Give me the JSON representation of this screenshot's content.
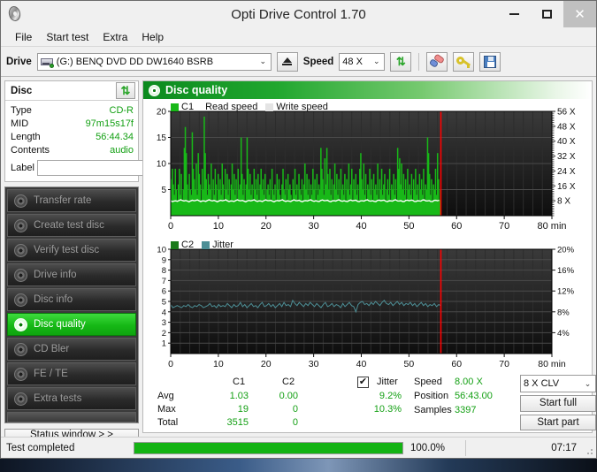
{
  "window": {
    "title": "Opti Drive Control 1.70",
    "app_icon": "disc-icon",
    "minimize": "–",
    "maximize": "□",
    "close": "✕"
  },
  "menu": {
    "items": [
      {
        "label": "File"
      },
      {
        "label": "Start test"
      },
      {
        "label": "Extra"
      },
      {
        "label": "Help"
      }
    ]
  },
  "toolbar": {
    "drive_label": "Drive",
    "drive_value": "(G:)   BENQ DVD DD DW1640 BSRB",
    "eject_icon": "eject-icon",
    "speed_label": "Speed",
    "speed_value": "48 X",
    "refresh_icon": "refresh-icon",
    "erase_icon": "erase-icon",
    "key_icon": "key-icon",
    "save_icon": "save-icon",
    "dropdown_arrow": "⌄"
  },
  "disc_panel": {
    "title": "Disc",
    "refresh_icon": "refresh-icon",
    "rows": [
      {
        "key": "Type",
        "value": "CD-R"
      },
      {
        "key": "MID",
        "value": "97m15s17f"
      },
      {
        "key": "Length",
        "value": "56:44.34"
      },
      {
        "key": "Contents",
        "value": "audio"
      }
    ],
    "label_key": "Label",
    "label_value": "",
    "label_placeholder": "",
    "label_disc_icon": "cd-icon"
  },
  "sidebar": {
    "items": [
      {
        "label": "Transfer rate",
        "icon": "disc-test-icon",
        "active": false
      },
      {
        "label": "Create test disc",
        "icon": "disc-test-icon",
        "active": false
      },
      {
        "label": "Verify test disc",
        "icon": "disc-test-icon",
        "active": false
      },
      {
        "label": "Drive info",
        "icon": "disc-test-icon",
        "active": false
      },
      {
        "label": "Disc info",
        "icon": "disc-test-icon",
        "active": false
      },
      {
        "label": "Disc quality",
        "icon": "disc-test-icon",
        "active": true
      },
      {
        "label": "CD Bler",
        "icon": "disc-test-icon",
        "active": false
      },
      {
        "label": "FE / TE",
        "icon": "disc-test-icon",
        "active": false
      },
      {
        "label": "Extra tests",
        "icon": "disc-test-icon",
        "active": false
      }
    ],
    "status_window_button": "Status window > >"
  },
  "panel": {
    "header_title": "Disc quality",
    "header_icon": "disc-quality-icon"
  },
  "chart_data": [
    {
      "type": "area",
      "name": "c1-chart",
      "title": "",
      "legend": [
        {
          "label": "C1",
          "color": "#18b818",
          "swatch": true
        },
        {
          "label": "Read speed",
          "color": "#ffffff",
          "swatch": false
        },
        {
          "label": "Write speed",
          "color": "#e8e8e8",
          "swatch": true
        }
      ],
      "xlabel": "min",
      "xlim": [
        0,
        80
      ],
      "xticks": [
        0,
        10,
        20,
        30,
        40,
        50,
        60,
        70,
        80
      ],
      "ylabel": "",
      "ylim": [
        0,
        20
      ],
      "yticks": [
        5,
        10,
        15,
        20
      ],
      "y2label": "",
      "y2lim": [
        0,
        56
      ],
      "y2ticks": [
        8,
        16,
        24,
        32,
        40,
        48,
        56
      ],
      "y2ticklabels": [
        "8 X",
        "16 X",
        "24 X",
        "32 X",
        "40 X",
        "48 X",
        "56 X"
      ],
      "grid": true,
      "marker_x": 56.7,
      "marker_color": "#ff0000",
      "series": [
        {
          "name": "C1",
          "color": "#18b818",
          "type": "impulse",
          "x_end": 56.7,
          "values": [
            7,
            9,
            6,
            4,
            9,
            5,
            3,
            6,
            9,
            4,
            8,
            2,
            5,
            13,
            17,
            12,
            6,
            3,
            8,
            5,
            4,
            16,
            9,
            7,
            5,
            10,
            4,
            12,
            8,
            6,
            3,
            9,
            5,
            19,
            12,
            7,
            4,
            8,
            6,
            5,
            10,
            3,
            7,
            4,
            9,
            6,
            3,
            8,
            5,
            7,
            4,
            10,
            6,
            3,
            9,
            5,
            8,
            4,
            7,
            3,
            6,
            10,
            5,
            8,
            4,
            7,
            3,
            9,
            5,
            6,
            15,
            8,
            4,
            7,
            3,
            6,
            15,
            9,
            5,
            8,
            4,
            6,
            3,
            9,
            5,
            7,
            4,
            8,
            3,
            6,
            9,
            5,
            7,
            4,
            8,
            3,
            5,
            6,
            4,
            7,
            3,
            9,
            5,
            4,
            6,
            3,
            8,
            5,
            7,
            4,
            3,
            6,
            9,
            5,
            4,
            7,
            3,
            8,
            5,
            6,
            4,
            3,
            7,
            5,
            9,
            4,
            6,
            3,
            8,
            5,
            4,
            7,
            3,
            6,
            10,
            5,
            8,
            4,
            7,
            3,
            6,
            4,
            9,
            5,
            7,
            3,
            8,
            4,
            6,
            5,
            13,
            9,
            7,
            4,
            11,
            6,
            13,
            8,
            5,
            9,
            4,
            7,
            3,
            6,
            10,
            5,
            8,
            4,
            7,
            3,
            9,
            5,
            6,
            4,
            8,
            3,
            7,
            5,
            10,
            4,
            6,
            9,
            3,
            7,
            5,
            8,
            4,
            6,
            3,
            9,
            12,
            7,
            5,
            10,
            4,
            8,
            3,
            6,
            5,
            9,
            4,
            7,
            3,
            8,
            5,
            6,
            4,
            10,
            3,
            7,
            5,
            9,
            4,
            6,
            8,
            3,
            5,
            7,
            4,
            9,
            3,
            6,
            5,
            8,
            4,
            7,
            3,
            13,
            9,
            11,
            6,
            10,
            5,
            8,
            4,
            7,
            3,
            9,
            5,
            6,
            4,
            8,
            3,
            7,
            5,
            9,
            4,
            6,
            3,
            8,
            5,
            7,
            4,
            9,
            3,
            6,
            5,
            15,
            12,
            8,
            4,
            7,
            3,
            6,
            5,
            9,
            4,
            12,
            7,
            3,
            5
          ]
        },
        {
          "name": "Read speed",
          "color": "#ffffff",
          "type": "line",
          "x_end": 56.7,
          "approx_value_x": 8.0,
          "note": "flat white read-speed trace at approximately 8 X across the scanned region"
        }
      ]
    },
    {
      "type": "line",
      "name": "c2-jitter-chart",
      "title": "",
      "legend": [
        {
          "label": "C2",
          "color": "#1a7a1a",
          "swatch": true
        },
        {
          "label": "Jitter",
          "color": "#4d8f96",
          "swatch": true
        }
      ],
      "xlabel": "min",
      "xlim": [
        0,
        80
      ],
      "xticks": [
        0,
        10,
        20,
        30,
        40,
        50,
        60,
        70,
        80
      ],
      "ylim": [
        0,
        10
      ],
      "yticks": [
        1,
        2,
        3,
        4,
        5,
        6,
        7,
        8,
        9,
        10
      ],
      "y2lim": [
        0,
        20
      ],
      "y2ticks": [
        4,
        8,
        12,
        16,
        20
      ],
      "y2ticklabels": [
        "4%",
        "8%",
        "12%",
        "16%",
        "20%"
      ],
      "grid": true,
      "marker_x": 56.7,
      "marker_color": "#ff0000",
      "series": [
        {
          "name": "Jitter",
          "color": "#4d8f96",
          "type": "line",
          "x_end": 56.7,
          "values": [
            4.7,
            4.4,
            4.5,
            4.6,
            4.5,
            4.4,
            4.6,
            4.5,
            4.7,
            4.5,
            4.4,
            4.6,
            4.5,
            4.7,
            4.6,
            4.4,
            4.5,
            4.6,
            4.8,
            4.5,
            4.6,
            4.4,
            4.7,
            4.5,
            4.6,
            4.5,
            4.8,
            4.6,
            4.4,
            4.7,
            4.5,
            4.6,
            4.9,
            4.5,
            4.7,
            4.4,
            4.6,
            4.8,
            4.5,
            4.6,
            4.4,
            4.7,
            4.9,
            4.5,
            4.6,
            4.8,
            4.5,
            4.7,
            4.4,
            4.6,
            4.8,
            4.5,
            4.9,
            4.6,
            4.7,
            4.5,
            5.1,
            4.8,
            4.6,
            4.9,
            4.7,
            4.5,
            4.8,
            4.6,
            4.9,
            4.7,
            4.5,
            4.8,
            4.6,
            4.4,
            4.7,
            4.9,
            4.5,
            4.6,
            4.8,
            4.5,
            4.7,
            4.6,
            4.4,
            4.8,
            4.5,
            4.7,
            4.9,
            4.6,
            4.5,
            4.0,
            4.7,
            4.9,
            5.0,
            4.7,
            4.8,
            4.6,
            4.9,
            4.7,
            5.0,
            4.8,
            4.6,
            4.9,
            5.1,
            4.8,
            4.7,
            4.9,
            4.6,
            4.8,
            5.0,
            4.7,
            4.9,
            4.6,
            4.8,
            4.7,
            4.9,
            4.6,
            4.8,
            4.5,
            4.7,
            4.9,
            4.6,
            4.8,
            4.5,
            4.7,
            4.6,
            4.8,
            4.5,
            4.7,
            4.6
          ]
        },
        {
          "name": "C2",
          "color": "#1a7a1a",
          "type": "impulse",
          "values": []
        }
      ]
    }
  ],
  "stats": {
    "col_headers": [
      "C1",
      "C2"
    ],
    "row_labels": [
      "Avg",
      "Max",
      "Total"
    ],
    "c1": [
      "1.03",
      "19",
      "3515"
    ],
    "c2": [
      "0.00",
      "0",
      "0"
    ],
    "jitter_label": "Jitter",
    "jitter_checked": "✔",
    "jitter_avg": "9.2%",
    "jitter_max": "10.3%",
    "speed_label": "Speed",
    "speed_value": "8.00 X",
    "position_label": "Position",
    "position_value": "56:43.00",
    "samples_label": "Samples",
    "samples_value": "3397",
    "clv_value": "8 X CLV",
    "start_full": "Start full",
    "start_part": "Start part"
  },
  "statusbar": {
    "text": "Test completed",
    "progress_pct": 100.0,
    "progress_label": "100.0%",
    "time": "07:17"
  },
  "colors": {
    "accent_green": "#14a014",
    "c1_green": "#18b818",
    "jitter_teal": "#4d8f96",
    "marker_red": "#ff0000",
    "chart_bg": "#1a1a1a"
  }
}
